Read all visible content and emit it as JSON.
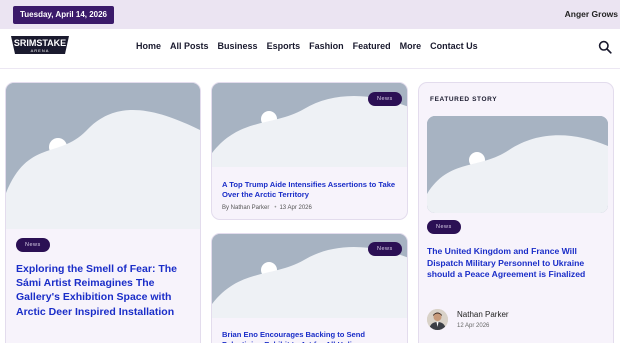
{
  "topbar": {
    "date": "Tuesday, April 14, 2026",
    "ticker": "Anger Grows"
  },
  "header": {
    "logo": {
      "line1": "SRIMSTAKE",
      "line2": "ARENA"
    },
    "nav": [
      "Home",
      "All Posts",
      "Business",
      "Esports",
      "Fashion",
      "Featured",
      "More",
      "Contact Us"
    ],
    "search_icon": "search-icon"
  },
  "posts": {
    "large": {
      "badge": "News",
      "title": "Exploring the Smell of Fear: The Sámi Artist Reimagines The Gallery's Exhibition Space with Arctic Deer Inspired Installation"
    },
    "middle_top": {
      "badge": "News",
      "title": "A Top Trump Aide Intensifies Assertions to Take Over the Arctic Territory",
      "author": "By Nathan Parker",
      "date": "13 Apr 2026"
    },
    "middle_bottom": {
      "badge": "News",
      "title": "Brian Eno Encourages Backing to Send Palestinian Exhibit to Art for All Holi"
    }
  },
  "featured": {
    "label": "FEATURED STORY",
    "badge": "News",
    "title": "The United Kingdom and France Will Dispatch Military Personnel to Ukraine should a Peace Agreement is Finalized",
    "author": "Nathan Parker",
    "date": "12 Apr 2026"
  },
  "colors": {
    "accent": "#3b1a6a",
    "title": "#1a2dc8",
    "placeholder": "#a7b3c2"
  }
}
